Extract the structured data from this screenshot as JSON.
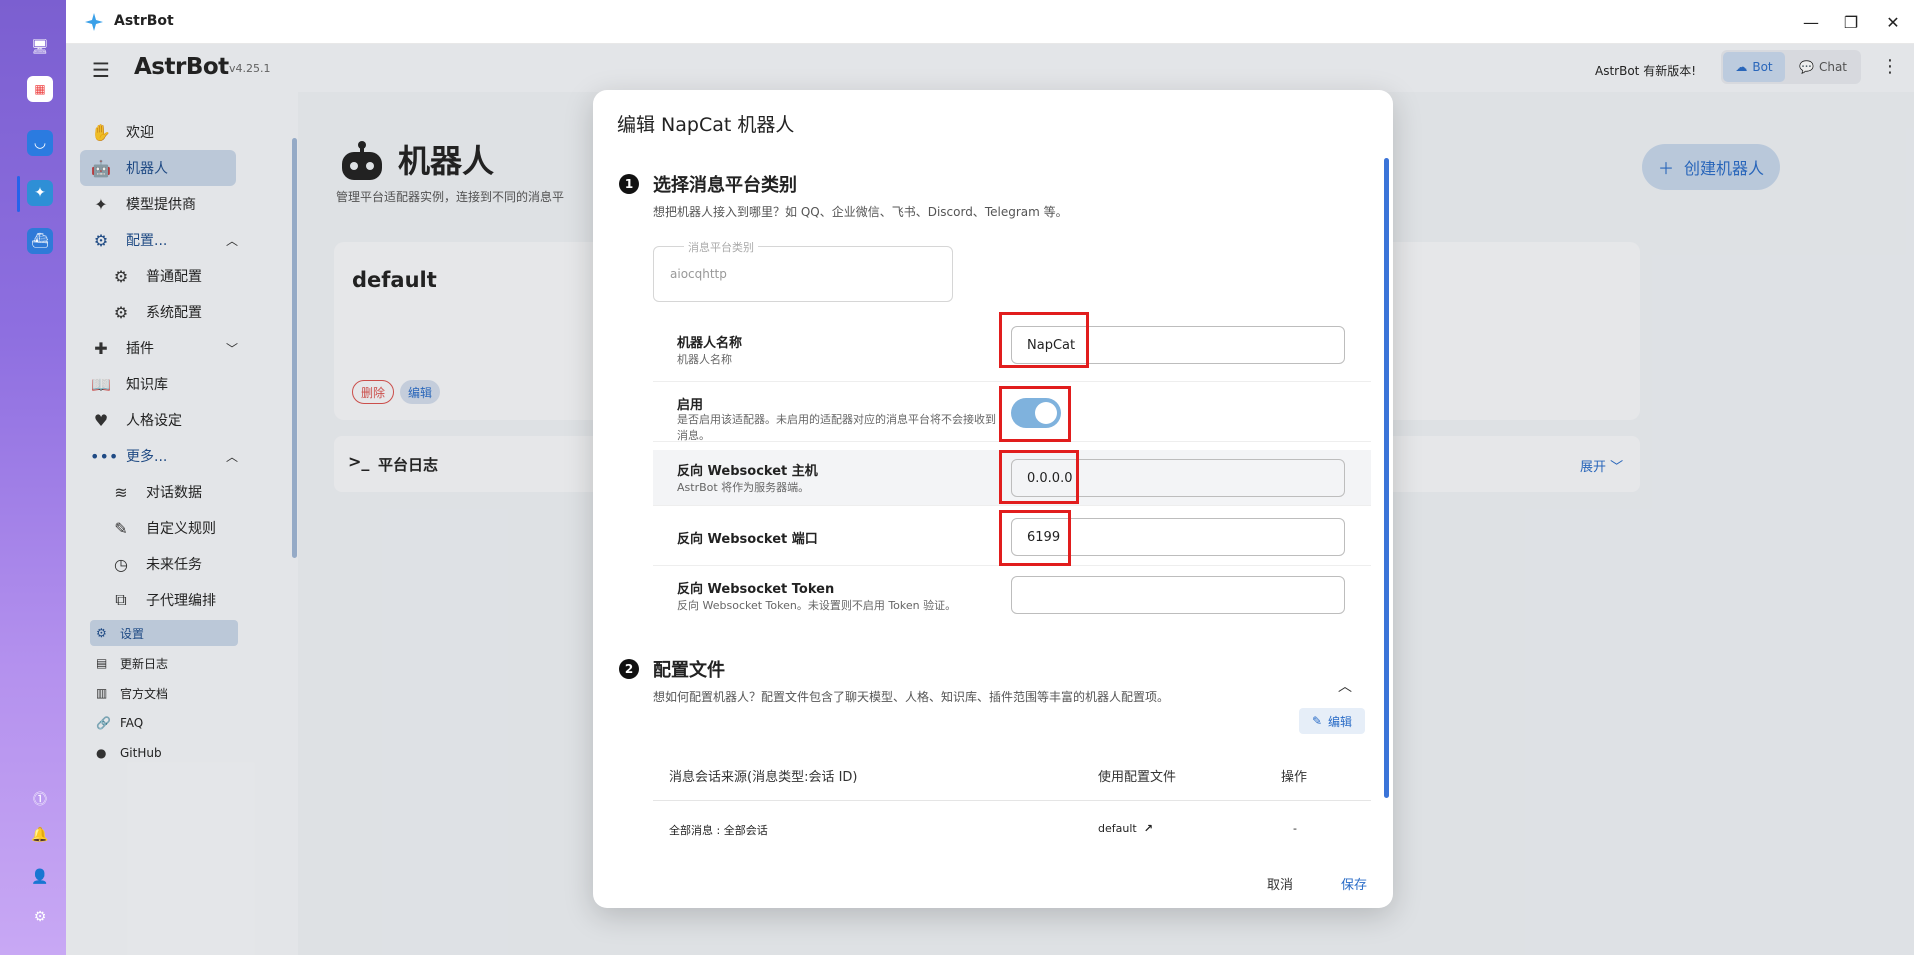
{
  "window": {
    "title": "AstrBot",
    "minimize": "—",
    "maximize": "❐",
    "close": "✕"
  },
  "topbar": {
    "brand": "AstrBot",
    "version": "v4.25.1",
    "update_notice": "AstrBot 有新版本!",
    "bot_tab": "Bot",
    "chat_tab": "Chat"
  },
  "sidebar": {
    "items": [
      {
        "label": "欢迎",
        "icon": "wave-hand-icon"
      },
      {
        "label": "机器人",
        "icon": "robot-icon"
      },
      {
        "label": "模型提供商",
        "icon": "sparkle-icon"
      },
      {
        "label": "配置...",
        "icon": "gear-icon"
      },
      {
        "label": "普通配置",
        "icon": "gear-icon"
      },
      {
        "label": "系统配置",
        "icon": "gear-outline-icon"
      },
      {
        "label": "插件",
        "icon": "puzzle-icon"
      },
      {
        "label": "知识库",
        "icon": "book-icon"
      },
      {
        "label": "人格设定",
        "icon": "heart-icon"
      },
      {
        "label": "更多...",
        "icon": "dots-icon"
      },
      {
        "label": "对话数据",
        "icon": "database-icon"
      },
      {
        "label": "自定义规则",
        "icon": "wand-icon"
      },
      {
        "label": "未来任务",
        "icon": "clock-icon"
      },
      {
        "label": "子代理编排",
        "icon": "layers-icon"
      }
    ],
    "footer": [
      {
        "label": "设置",
        "icon": "gear-icon"
      },
      {
        "label": "更新日志",
        "icon": "log-icon"
      },
      {
        "label": "官方文档",
        "icon": "docs-icon"
      },
      {
        "label": "FAQ",
        "icon": "link-icon"
      },
      {
        "label": "GitHub",
        "icon": "github-icon"
      }
    ]
  },
  "page": {
    "title": "机器人",
    "subtitle": "管理平台适配器实例，连接到不同的消息平",
    "create_button": "创建机器人",
    "card_title": "default",
    "delete_chip": "删除",
    "edit_chip": "编辑",
    "log_title": "平台日志",
    "expand": "展开"
  },
  "dialog": {
    "title": "编辑 NapCat 机器人",
    "step1": {
      "num": "1",
      "title": "选择消息平台类别",
      "desc": "想把机器人接入到哪里？如 QQ、企业微信、飞书、Discord、Telegram 等。"
    },
    "platform": {
      "legend": "消息平台类别",
      "value": "aiocqhttp"
    },
    "fields": {
      "name": {
        "label": "机器人名称",
        "desc": "机器人名称",
        "value": "NapCat"
      },
      "enable": {
        "label": "启用",
        "desc": "是否启用该适配器。未启用的适配器对应的消息平台将不会接收到消息。",
        "on": true
      },
      "ws_host": {
        "label": "反向 Websocket 主机",
        "desc": "AstrBot 将作为服务器端。",
        "value": "0.0.0.0"
      },
      "ws_port": {
        "label": "反向 Websocket 端口",
        "value": "6199"
      },
      "ws_token": {
        "label": "反向 Websocket Token",
        "desc": "反向 Websocket Token。未设置则不启用 Token 验证。",
        "value": ""
      }
    },
    "step2": {
      "num": "2",
      "title": "配置文件",
      "desc": "想如何配置机器人？配置文件包含了聊天模型、人格、知识库、插件范围等丰富的机器人配置项。",
      "edit": "编辑"
    },
    "table": {
      "headers": [
        "消息会话来源(消息类型:会话 ID)",
        "使用配置文件",
        "操作"
      ],
      "rows": [
        {
          "source": "全部消息 : 全部会话",
          "config": "default",
          "action": "-"
        }
      ]
    },
    "cancel": "取消",
    "save": "保存"
  }
}
